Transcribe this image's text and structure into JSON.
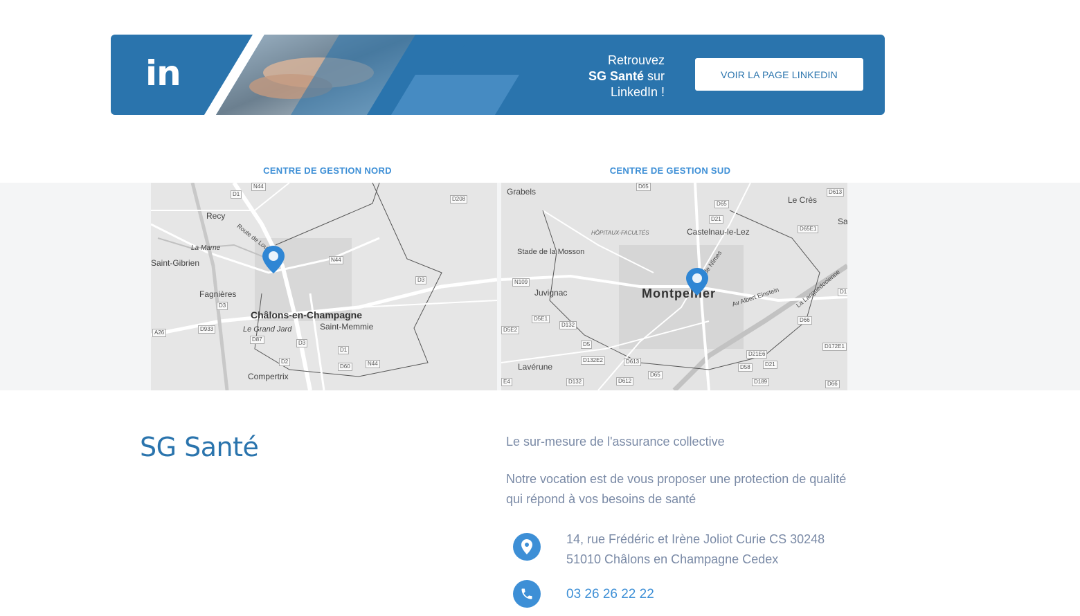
{
  "linkedin_banner": {
    "logo_text": "in",
    "text_line1": "Retrouvez",
    "text_brand": "SG Santé",
    "text_line2_suffix": " sur",
    "text_line3": "LinkedIn !",
    "button_label": "VOIR LA PAGE LINKEDIN",
    "colors": {
      "background": "#2a74ad",
      "button_text": "#2a74ad"
    }
  },
  "centres": {
    "nord": {
      "title": "CENTRE DE GESTION NORD",
      "map_labels": [
        "Recy",
        "La Marne",
        "Saint-Gibrien",
        "Fagnières",
        "Châlons-en-Champagne",
        "Saint-Memmie",
        "Le Grand Jard",
        "Compertrix",
        "Route de Louvois"
      ],
      "road_labels": [
        "N44",
        "D1",
        "D208",
        "N44",
        "D3",
        "D3",
        "A26",
        "D933",
        "D87",
        "D3",
        "D1",
        "D2",
        "D60",
        "N44"
      ]
    },
    "sud": {
      "title": "CENTRE DE GESTION SUD",
      "map_labels": [
        "Grabels",
        "Le Crès",
        "Sa",
        "HÔPITAUX-FACULTÉS",
        "Castelnau-le-Lez",
        "Stade de la Mosson",
        "Juvignac",
        "Montpellier",
        "Av Albert Einstein",
        "La Languedocienne",
        "Lavérune",
        "de Nîmes"
      ],
      "road_labels": [
        "D65",
        "D613",
        "D65",
        "D21",
        "D65E1",
        "N109",
        "D1",
        "D5E1",
        "D132",
        "D5E2",
        "D5",
        "D132E2",
        "D613",
        "D66",
        "D172E1",
        "D21E6",
        "D58",
        "D21",
        "E4",
        "D132",
        "D612",
        "D65",
        "D189",
        "D66"
      ]
    }
  },
  "footer": {
    "brand": "SG Santé",
    "tagline": "Le sur-mesure de l'assurance collective",
    "vocation": "Notre vocation est de vous proposer une protection de qualité qui répond à vos besoins de santé",
    "address_line1": "14, rue Frédéric et Irène Joliot Curie CS 30248",
    "address_line2": "51010 Châlons en Champagne Cedex",
    "phone": "03 26 26 22 22",
    "icons": [
      "location-pin-icon",
      "phone-icon"
    ],
    "colors": {
      "brand": "#2a74ad",
      "accent": "#3d8fd6",
      "text": "#7a8aa6"
    }
  }
}
